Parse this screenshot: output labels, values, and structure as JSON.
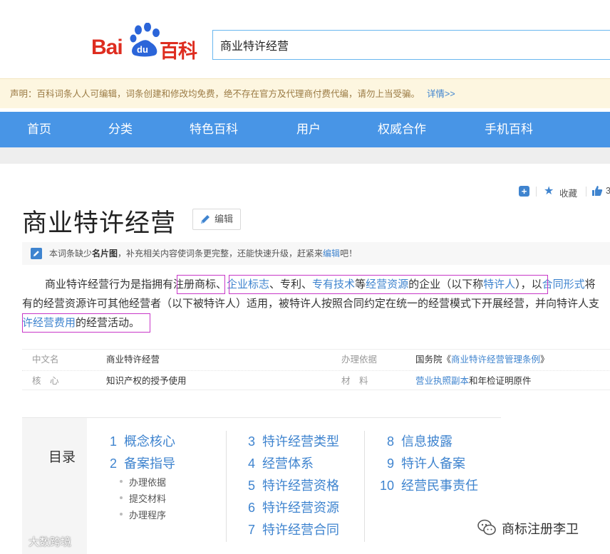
{
  "header": {
    "logo_text_bai": "Bai",
    "logo_text_du": "du",
    "logo_text_baike": "百科",
    "search_value": "商业特许经营"
  },
  "notice": {
    "text": "声明：百科词条人人可编辑，词条创建和修改均免费，绝不存在官方及代理商付费代编，请勿上当受骗。",
    "more": "详情>>"
  },
  "nav": [
    "首页",
    "分类",
    "特色百科",
    "用户",
    "权威合作",
    "手机百科"
  ],
  "actions": {
    "favorite": "收藏",
    "like_count": "3"
  },
  "title": "商业特许经营",
  "edit_label": "编辑",
  "tip": {
    "pre": "本词条缺少",
    "bold": "名片图",
    "mid": "，补充相关内容使词条更完整，还能快速升级，赶紧来",
    "link": "编辑",
    "post": "吧！"
  },
  "summary": {
    "l1_a": "商业特许经营行为是指拥有注册商标、",
    "l1_b": "企业标志",
    "l1_c": "、专利、",
    "l1_d": "专有技术",
    "l1_e": "等",
    "l1_f": "经营资源",
    "l1_g": "的企业（以下称",
    "l1_h": "特许人",
    "l1_i": "），以",
    "l1_j": "合同形式",
    "l1_k": "将",
    "l2": "有的经营资源许可其他经营者（以下被特许人）适用，被特许人按照合同约定在统一的经营模式下开展经营，并向特许人支",
    "l3_a": "许经营费用",
    "l3_b": "的经营活动。"
  },
  "info": {
    "rows": [
      {
        "k1": "中文名",
        "v1": "商业特许经营",
        "k2": "办理依据",
        "v2_a": "国务院《",
        "v2_link": "商业特许经营管理条例",
        "v2_b": "》"
      },
      {
        "k1": "核　心",
        "v1": "知识产权的授予使用",
        "k2": "材　料",
        "v2_link": "营业执照副本",
        "v2_b": "和年检证明原件"
      }
    ]
  },
  "catalog": {
    "label": "目录",
    "col1": [
      {
        "num": "1",
        "text": "概念核心"
      },
      {
        "num": "2",
        "text": "备案指导"
      }
    ],
    "col1_sub": [
      "办理依据",
      "提交材料",
      "办理程序"
    ],
    "col2": [
      {
        "num": "3",
        "text": "特许经营类型"
      },
      {
        "num": "4",
        "text": "经营体系"
      },
      {
        "num": "5",
        "text": "特许经营资格"
      },
      {
        "num": "6",
        "text": "特许经营资源"
      },
      {
        "num": "7",
        "text": "特许经营合同"
      }
    ],
    "col3": [
      {
        "num": "8",
        "text": "信息披露"
      },
      {
        "num": "9",
        "text": "特许人备案"
      },
      {
        "num": "10",
        "text": "经营民事责任"
      }
    ]
  },
  "watermark": {
    "left": "大数跨境",
    "right": "商标注册李卫"
  },
  "colors": {
    "nav_blue": "#4895e6",
    "link_blue": "#3f84cf",
    "logo_red": "#de2d20",
    "highlight_magenta": "#c837c8"
  }
}
